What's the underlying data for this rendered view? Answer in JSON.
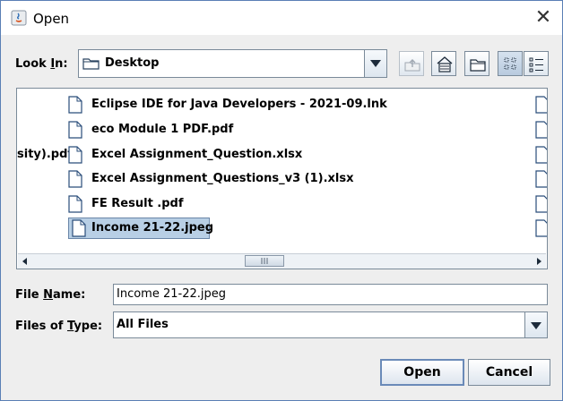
{
  "window": {
    "title": "Open",
    "close_icon": "close-icon"
  },
  "look_in": {
    "label_prefix": "Look ",
    "label_mnemonic": "I",
    "label_suffix": "n:",
    "value": "Desktop"
  },
  "toolbar": {
    "up_one_level": "folder-up-icon",
    "home": "home-icon",
    "new_folder": "new-folder-icon",
    "list_view": "list-view-icon",
    "details_view": "details-view-icon"
  },
  "files": {
    "left_column_partial": "sity).pdf",
    "items": [
      {
        "name": "Eclipse IDE for Java Developers - 2021-09.lnk"
      },
      {
        "name": "eco Module 1 PDF.pdf"
      },
      {
        "name": "Excel Assignment_Question.xlsx"
      },
      {
        "name": "Excel Assignment_Questions_v3 (1).xlsx"
      },
      {
        "name": "FE Result .pdf"
      },
      {
        "name": "Income 21-22.jpeg",
        "selected": true
      }
    ]
  },
  "file_name": {
    "label_prefix": "File ",
    "label_mnemonic": "N",
    "label_suffix": "ame:",
    "value": "Income 21-22.jpeg"
  },
  "files_of_type": {
    "label_prefix": "Files of ",
    "label_mnemonic": "T",
    "label_suffix": "ype:",
    "value": "All Files"
  },
  "buttons": {
    "open": "Open",
    "cancel": "Cancel"
  },
  "colors": {
    "selection": "#b8cfe5",
    "border": "#7a8a99",
    "dialog_bg": "#eeeeee"
  }
}
